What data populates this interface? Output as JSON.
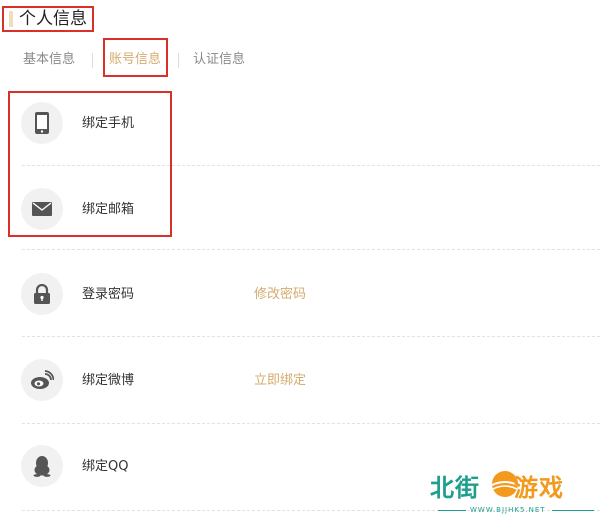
{
  "page": {
    "title": "个人信息"
  },
  "tabs": [
    {
      "label": "基本信息",
      "active": false
    },
    {
      "label": "账号信息",
      "active": true
    },
    {
      "label": "认证信息",
      "active": false
    }
  ],
  "rows": [
    {
      "icon": "phone-icon",
      "label": "绑定手机",
      "action": ""
    },
    {
      "icon": "mail-icon",
      "label": "绑定邮箱",
      "action": ""
    },
    {
      "icon": "lock-icon",
      "label": "登录密码",
      "action": "修改密码"
    },
    {
      "icon": "weibo-icon",
      "label": "绑定微博",
      "action": "立即绑定"
    },
    {
      "icon": "qq-icon",
      "label": "绑定QQ",
      "action": ""
    }
  ],
  "watermark": {
    "text_left": "北街",
    "text_right": "游戏",
    "url": "WWW.BJJHK5.NET"
  },
  "colors": {
    "accent": "#d6ab6e",
    "highlight_border": "#d9302a",
    "icon_bg": "#f1f1f1",
    "icon_fg": "#555555"
  }
}
